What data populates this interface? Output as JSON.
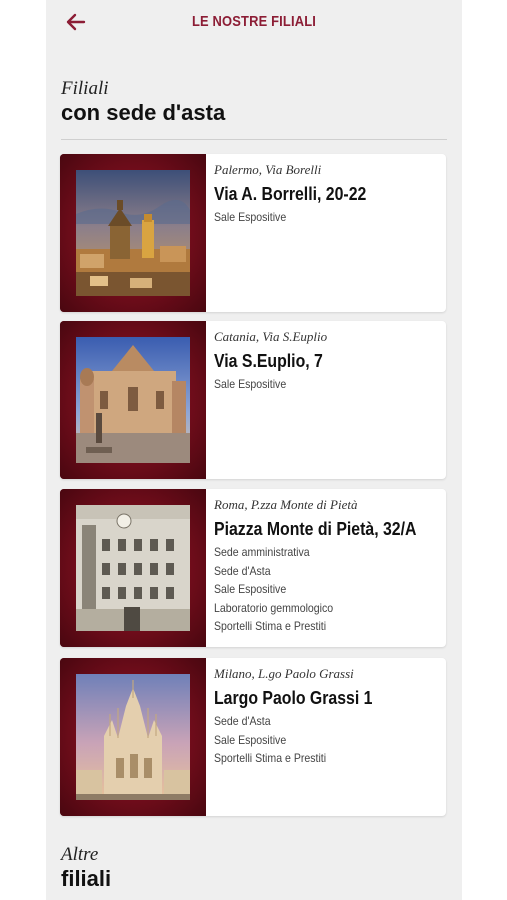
{
  "header": {
    "title": "LE NOSTRE FILIALI",
    "back_icon": "arrow-left-icon"
  },
  "colors": {
    "brand": "#8c1d35",
    "frame": "#7a0f22",
    "background": "#efefef"
  },
  "section_auction": {
    "kicker": "Filiali",
    "title": "con sede d'asta"
  },
  "branches": [
    {
      "city": "Palermo, Via Borelli",
      "street": "Via A. Borrelli, 20-22",
      "services": [
        "Sale Espositive"
      ],
      "photo": "palermo-cityscape"
    },
    {
      "city": "Catania, Via S.Euplio",
      "street": "Via S.Euplio, 7",
      "services": [
        "Sale Espositive"
      ],
      "photo": "catania-cathedral"
    },
    {
      "city": "Roma, P.zza Monte di Pietà",
      "street": "Piazza Monte di Pietà, 32/A",
      "services": [
        "Sede amministrativa",
        "Sede d'Asta",
        "Sale Espositive",
        "Laboratorio gemmologico",
        "Sportelli Stima e Prestiti"
      ],
      "photo": "roma-palazzo"
    },
    {
      "city": "Milano, L.go Paolo Grassi",
      "street": "Largo Paolo Grassi 1",
      "services": [
        "Sede d'Asta",
        "Sale Espositive",
        "Sportelli Stima e Prestiti"
      ],
      "photo": "milano-duomo"
    }
  ],
  "section_other": {
    "kicker": "Altre",
    "title": "filiali"
  }
}
